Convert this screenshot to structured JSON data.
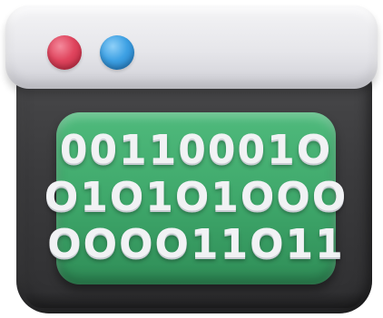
{
  "window": {
    "controls": [
      {
        "icon": "red-dot-icon",
        "color": "#e0455e"
      },
      {
        "icon": "blue-dot-icon",
        "color": "#3ea1e4"
      }
    ],
    "screen_color": "#3fa86b",
    "body_color": "#3b3b3d",
    "titlebar_color": "#e6e6ea"
  },
  "screen": {
    "rows": [
      "00110001O",
      "O1O1O1OOO",
      "OOOO11O11"
    ]
  }
}
